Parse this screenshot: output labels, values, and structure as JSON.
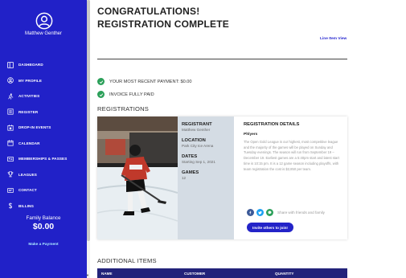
{
  "user": {
    "name": "Matthew Genther"
  },
  "sidebar": {
    "items": [
      {
        "label": "DASHBOARD",
        "icon": "dashboard-icon"
      },
      {
        "label": "MY PROFILE",
        "icon": "profile-icon"
      },
      {
        "label": "ACTIVITIES",
        "icon": "activities-icon"
      },
      {
        "label": "REGISTER",
        "icon": "register-icon"
      },
      {
        "label": "DROP-IN EVENTS",
        "icon": "drop-in-icon"
      },
      {
        "label": "CALENDAR",
        "icon": "calendar-icon"
      },
      {
        "label": "MEMBERSHIPS & PASSES",
        "icon": "membership-icon"
      },
      {
        "label": "LEAGUES",
        "icon": "trophy-icon"
      },
      {
        "label": "CONTACT",
        "icon": "contact-icon"
      },
      {
        "label": "BILLING",
        "icon": "dollar-icon"
      }
    ],
    "family_balance_label": "Family Balance",
    "family_balance_value": "$0.00",
    "make_payment_label": "Make a Payment"
  },
  "header": {
    "title_line1": "CONGRATULATIONS!",
    "title_line2": "REGISTRATION COMPLETE",
    "line_item_view": "Line Item View"
  },
  "status": {
    "recent_payment": "YOUR MOST RECENT PAYMENT: $0.00",
    "invoice": "INVOICE FULLY PAID"
  },
  "registrations": {
    "title": "REGISTRATIONS",
    "registrant_label": "REGISTRANT",
    "registrant_value": "Matthew Genther",
    "location_label": "LOCATION",
    "location_value": "Park City Ice Arena",
    "dates_label": "DATES",
    "dates_value": "Starting Sep 1, 2021",
    "games_label": "GAMES",
    "games_value": "12",
    "details_title": "REGISTRATION DETAILS",
    "details_sub": "Phlyers",
    "details_desc": "The Open Gold League is our highest, most competitive league and the majority of the games will be played on Sunday and Tuesday evenings. The season will run from September 19 – December 19. Earliest games are a 5:40pm start and latest start time is 10:15 pm. It is a 12 game season including playoffs, with team registration the cost is $2,850 per team.",
    "share_text": "Share with friends and family",
    "invite_label": "Invite others to join!"
  },
  "additional": {
    "title": "ADDITIONAL ITEMS",
    "columns": [
      "NAME",
      "CUSTOMER",
      "QUANTITY"
    ]
  },
  "colors": {
    "sidebar": "#2121c8",
    "accent": "#2323c8",
    "success": "#2ca05a",
    "table_header": "#23237a",
    "facebook": "#3b5998",
    "twitter": "#1da1f2",
    "messenger": "#2ca05a"
  }
}
